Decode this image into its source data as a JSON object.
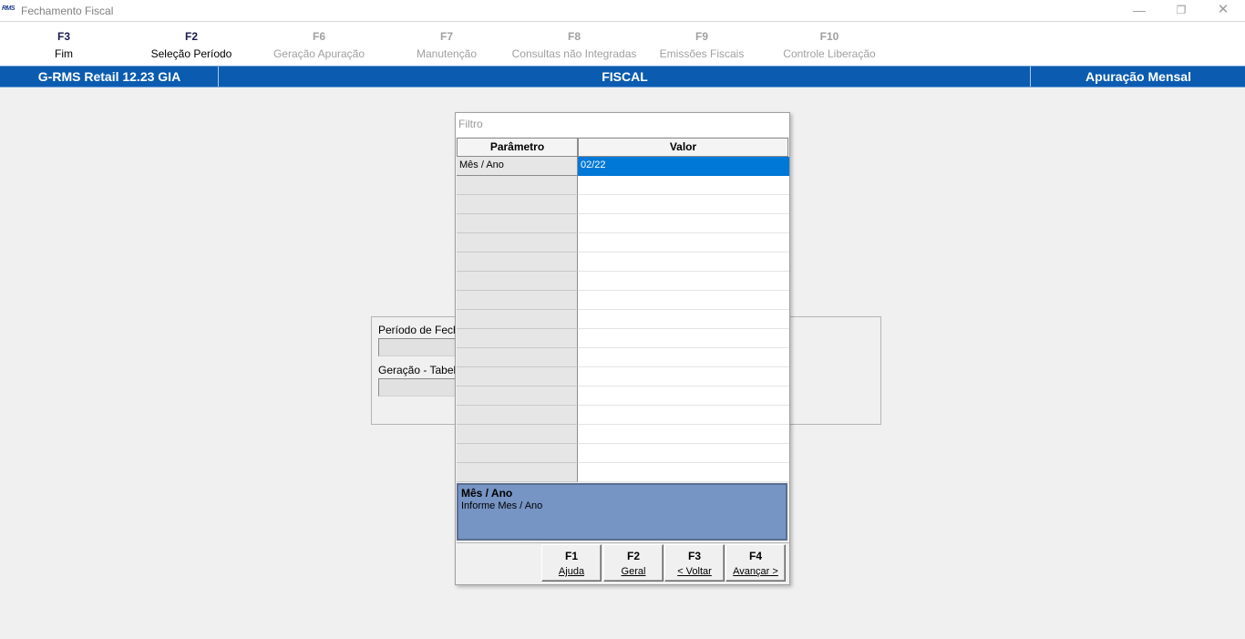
{
  "window": {
    "app_icon": "RMS",
    "title": "Fechamento Fiscal",
    "minimize": "—",
    "maximize": "❐",
    "close": "✕"
  },
  "fkeys": [
    {
      "key": "F3",
      "label": "Fim",
      "enabled": true
    },
    {
      "key": "F2",
      "label": "Seleção Período",
      "enabled": true
    },
    {
      "key": "F6",
      "label": "Geração Apuração",
      "enabled": false
    },
    {
      "key": "F7",
      "label": "Manutenção",
      "enabled": false
    },
    {
      "key": "F8",
      "label": "Consultas não Integradas",
      "enabled": false
    },
    {
      "key": "F9",
      "label": "Emissões Fiscais",
      "enabled": false
    },
    {
      "key": "F10",
      "label": "Controle Liberação",
      "enabled": false
    }
  ],
  "header": {
    "left": "G-RMS Retail 12.23 GIA",
    "center": "FISCAL",
    "right": "Apuração Mensal"
  },
  "background_form": {
    "period_label": "Período de Fecha",
    "generation_label": "Geração - Tabela"
  },
  "filter_dialog": {
    "caption": "Filtro",
    "columns": {
      "param": "Parâmetro",
      "value": "Valor"
    },
    "rows": [
      {
        "param": "Mês / Ano",
        "value": "02/22"
      },
      {
        "param": "",
        "value": ""
      },
      {
        "param": "",
        "value": ""
      },
      {
        "param": "",
        "value": ""
      },
      {
        "param": "",
        "value": ""
      },
      {
        "param": "",
        "value": ""
      },
      {
        "param": "",
        "value": ""
      },
      {
        "param": "",
        "value": ""
      },
      {
        "param": "",
        "value": ""
      },
      {
        "param": "",
        "value": ""
      },
      {
        "param": "",
        "value": ""
      },
      {
        "param": "",
        "value": ""
      },
      {
        "param": "",
        "value": ""
      },
      {
        "param": "",
        "value": ""
      },
      {
        "param": "",
        "value": ""
      },
      {
        "param": "",
        "value": ""
      },
      {
        "param": "",
        "value": ""
      }
    ],
    "description": {
      "title": "Mês / Ano",
      "text": "Informe Mes / Ano"
    },
    "buttons": [
      {
        "key": "F1",
        "label": "Ajuda"
      },
      {
        "key": "F2",
        "label": "Geral"
      },
      {
        "key": "F3",
        "label": "< Voltar"
      },
      {
        "key": "F4",
        "label": "Avançar >"
      }
    ]
  },
  "colors": {
    "header_band": "#0b5cb0",
    "selected_cell": "#0078d7",
    "description_panel": "#7694c4"
  }
}
